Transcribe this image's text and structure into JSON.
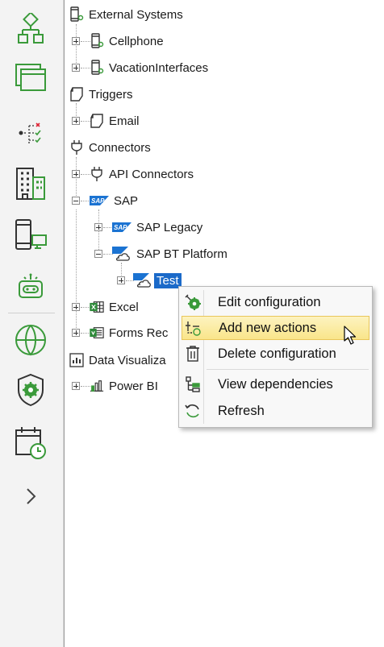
{
  "sidebar": {
    "icons": [
      {
        "name": "workflow-icon"
      },
      {
        "name": "window-icon"
      },
      {
        "name": "checklist-icon"
      },
      {
        "name": "buildings-icon"
      },
      {
        "name": "devices-icon"
      },
      {
        "name": "robot-icon"
      },
      {
        "name": "globe-icon"
      },
      {
        "name": "shield-gear-icon"
      },
      {
        "name": "calendar-clock-icon"
      },
      {
        "name": "chevron-right-icon"
      }
    ]
  },
  "tree": {
    "external_systems": "External Systems",
    "cellphone": "Cellphone",
    "vacation_interfaces": "VacationInterfaces",
    "triggers": "Triggers",
    "email": "Email",
    "connectors": "Connectors",
    "api_connectors": "API Connectors",
    "sap": "SAP",
    "sap_legacy": "SAP Legacy",
    "sap_bt_platform": "SAP BT Platform",
    "test": "Test",
    "excel": "Excel",
    "forms_rec": "Forms Rec",
    "data_visualiza": "Data Visualiza",
    "power_bi": "Power BI",
    "sap_badge": "SAP"
  },
  "context_menu": {
    "items": [
      {
        "label": "Edit configuration",
        "icon": "gear-config-icon"
      },
      {
        "label": "Add new actions",
        "icon": "add-actions-icon",
        "highlighted": true
      },
      {
        "label": "Delete configuration",
        "icon": "trash-icon"
      },
      {
        "label": "View dependencies",
        "icon": "dependencies-icon"
      },
      {
        "label": "Refresh",
        "icon": "refresh-icon"
      }
    ]
  },
  "colors": {
    "accent": "#1b6ac9",
    "icon_green": "#3a9a3a",
    "highlight": "#f9e58a"
  }
}
